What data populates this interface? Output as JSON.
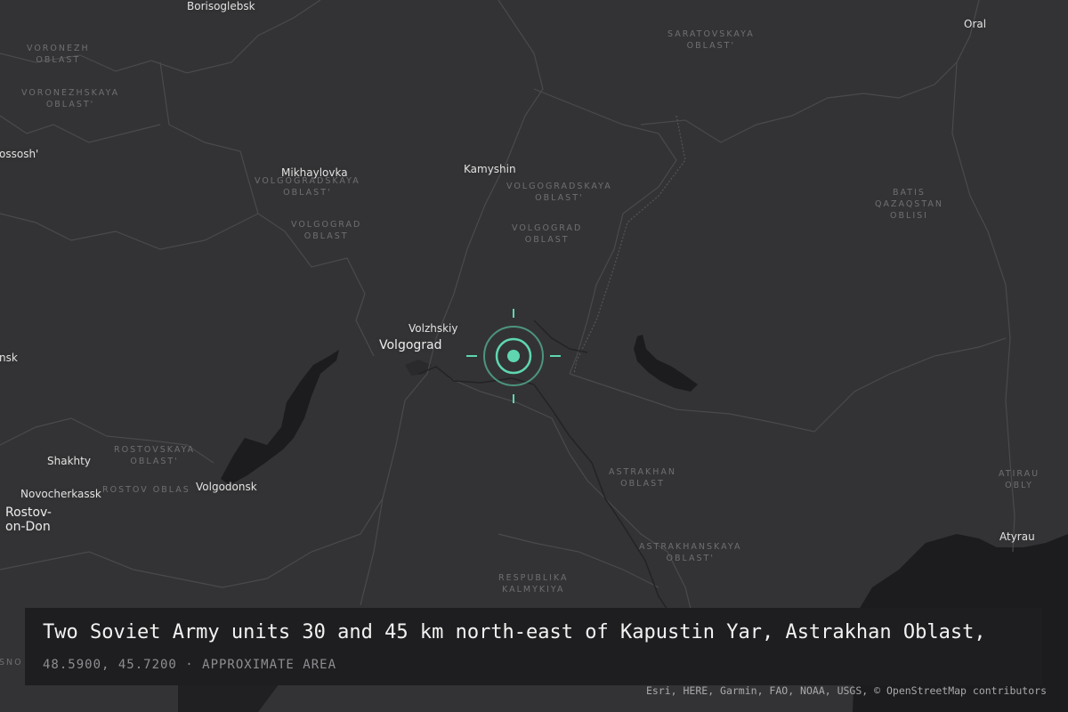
{
  "cities": {
    "borisoglebsk": "Borisoglebsk",
    "oral": "Oral",
    "rossosh": "ossosh'",
    "mikhaylovka": "Mikhaylovka",
    "kamyshin": "Kamyshin",
    "volzhskiy": "Volzhskiy",
    "volgograd": "Volgograd",
    "shakhty": "Shakhty",
    "novocherkassk": "Novocherkassk",
    "rostov_1": "Rostov-",
    "rostov_2": "on-Don",
    "volgodonsk": "Volgodonsk",
    "atyrau": "Atyrau",
    "edge_nsk": "nsk"
  },
  "regions": {
    "voronezh_1": "VORONEZH",
    "voronezh_2": "OBLAST",
    "voronezhskaya_1": "VORONEZHSKAYA",
    "voronezhskaya_2": "OBLAST'",
    "saratovskaya_1": "SARATOVSKAYA",
    "saratovskaya_2": "OBLAST'",
    "volgogradskaya_w_1": "VOLGOGRADSKAYA",
    "volgogradskaya_w_2": "OBLAST'",
    "volgograd_w_1": "VOLGOGRAD",
    "volgograd_w_2": "OBLAST",
    "volgogradskaya_e_1": "VOLGOGRADSKAYA",
    "volgogradskaya_e_2": "OBLAST'",
    "volgograd_e_1": "VOLGOGRAD",
    "volgograd_e_2": "OBLAST",
    "batis_1": "BATIS",
    "batis_2": "QAZAQSTAN",
    "batis_3": "OBLISI",
    "rostovskaya_1": "ROSTOVSKAYA",
    "rostovskaya_2": "OBLAST'",
    "rostov_obl": "ROSTOV OBLAS",
    "astrakhan_1": "ASTRAKHAN",
    "astrakhan_2": "OBLAST",
    "astrakhanskaya_1": "ASTRAKHANSKAYA",
    "astrakhanskaya_2": "OBLAST'",
    "kalmykiya_1": "RESPUBLIKA",
    "kalmykiya_2": "KALMYKIYA",
    "atirau_1": "ATIRAU",
    "atirau_2": "OBLY",
    "edge_sno": "SNO"
  },
  "marker": {
    "icon": "target-marker-icon",
    "color": "#5fd6b0",
    "lat": 48.59,
    "lon": 45.72
  },
  "caption": {
    "title": "Two Soviet Army units 30 and 45 km north-east of Kapustin Yar, Astrakhan Oblast,",
    "subtitle": "48.5900, 45.7200 · APPROXIMATE AREA"
  },
  "attribution": "Esri, HERE, Garmin, FAO, NOAA, USGS, © OpenStreetMap contributors",
  "colors": {
    "land": "#333335",
    "water": "#1c1c1e",
    "border": "#4a4a4d",
    "caption_bg": "#1e1e20"
  }
}
